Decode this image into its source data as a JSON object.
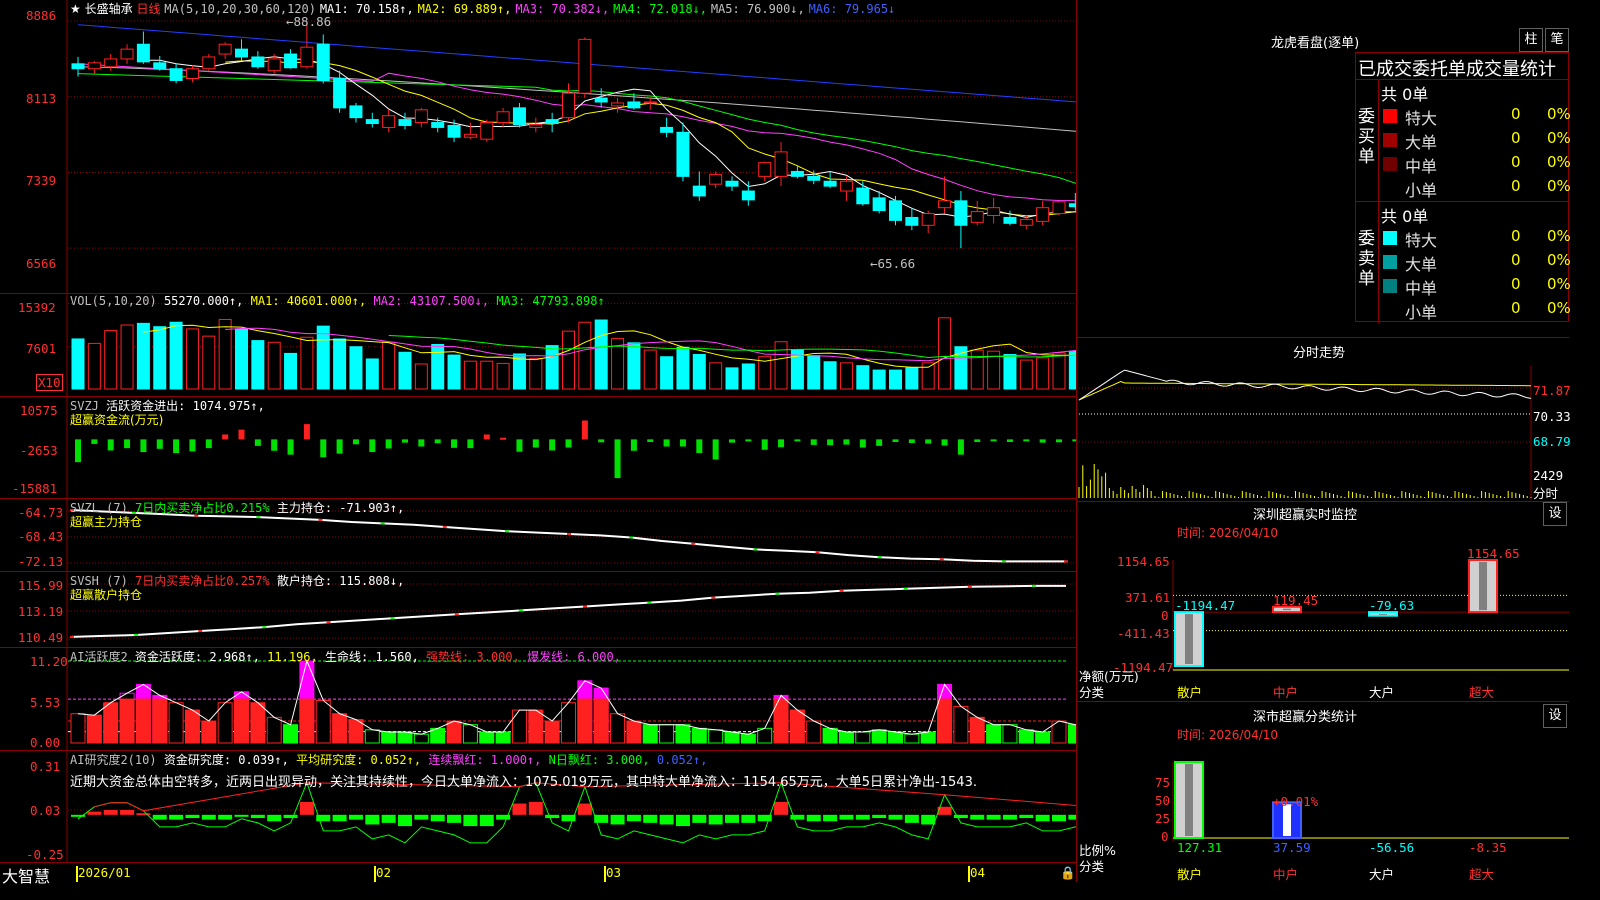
{
  "colors": {
    "up": "#ff2020",
    "down": "#00ffff",
    "ma1": "#ffffff",
    "ma2": "#ffff00",
    "ma3": "#ff40ff",
    "ma4": "#00ff00",
    "ma5": "#c0c0c0",
    "ma6": "#2040ff",
    "grid": "#8a0000"
  },
  "header": {
    "star_icon": "star-icon",
    "stock_name": "长盛轴承",
    "period": "日线",
    "ma_label": "MA(5,10,20,30,60,120)",
    "ma1": "MA1: 70.158↑,",
    "ma2": "MA2: 69.889↑,",
    "ma3": "MA3: 70.382↓,",
    "ma4": "MA4: 72.018↓,",
    "ma5": "MA5: 76.900↓,",
    "ma6": "MA6: 79.965↓"
  },
  "price_axis": [
    "8886",
    "8113",
    "7339",
    "6566"
  ],
  "price_marks": {
    "high": "88.86",
    "low": "65.66"
  },
  "vol": {
    "title": "VOL(5,10,20)",
    "value": "55270.000↑,",
    "ma1": "MA1: 40601.000↑,",
    "ma2": "MA2: 43107.500↓,",
    "ma3": "MA3: 47793.898↑",
    "axis": [
      "15392",
      "7601"
    ],
    "unit": "X10"
  },
  "svzj": {
    "title": "SVZJ",
    "text": "活跃资金进出: 1074.975↑,",
    "sub": "超赢资金流(万元)",
    "axis": [
      "10575",
      "-2653",
      "-15881"
    ]
  },
  "svzl": {
    "title": "SVZL (7)",
    "text1": "7日内买卖净占比0.215%",
    "text2": "主力持仓: -71.903↑,",
    "sub": "超赢主力持仓",
    "axis": [
      "-64.73",
      "-68.43",
      "-72.13"
    ]
  },
  "svsh": {
    "title": "SVSH (7)",
    "text1": "7日内买卖净占比0.257%",
    "text2": "散户持仓: 115.808↓,",
    "sub": "超赢散户持仓",
    "axis": [
      "115.99",
      "113.19",
      "110.49"
    ]
  },
  "ai1": {
    "title": "AI活跃度2",
    "t1": "资金活跃度: 2.968↑,",
    "t2": "11.196,",
    "t3": "生命线: 1.560,",
    "t4": "强势线: 3.000,",
    "t5": "爆发线: 6.000,",
    "axis": [
      "11.20",
      "5.53",
      "0.00"
    ]
  },
  "ai2": {
    "title": "AI研究度2(10)",
    "t1": "资金研究度: 0.039↑,",
    "t2": "平均研究度: 0.052↑,",
    "t3": "连续飘红: 1.000↑,",
    "t4": "N日飘红: 3.000,",
    "t5": "0.052↑,",
    "comment": "近期大资金总体由空转多，近两日出现异动，关注其持续性，今日大单净流入：1075.019万元，其中特大单净流入：1154.65万元，大单5日累计净出-1543.",
    "axis": [
      "0.31",
      "0.03",
      "-0.25"
    ]
  },
  "date_axis": [
    "2026/01",
    "02",
    "03",
    "04"
  ],
  "footer": {
    "brand": "大智慧",
    "lock_icon": "lock-icon"
  },
  "dragon": {
    "title": "龙虎看盘(逐单)",
    "btn1": "柱",
    "btn2": "笔",
    "tabs": "已成交委托单成交量统计",
    "buy_label": "委买单",
    "sell_label": "委卖单",
    "buy_total": "共 0单",
    "sell_total": "共 0单",
    "buy_rows": [
      {
        "name": "特大",
        "v": "0",
        "p": "0%",
        "c": "#ff0000"
      },
      {
        "name": "大单",
        "v": "0",
        "p": "0%",
        "c": "#a00000"
      },
      {
        "name": "中单",
        "v": "0",
        "p": "0%",
        "c": "#700000"
      },
      {
        "name": "小单",
        "v": "0",
        "p": "0%",
        "c": ""
      }
    ],
    "sell_rows": [
      {
        "name": "特大",
        "v": "0",
        "p": "0%",
        "c": "#00ffff"
      },
      {
        "name": "大单",
        "v": "0",
        "p": "0%",
        "c": "#00a0a0"
      },
      {
        "name": "中单",
        "v": "0",
        "p": "0%",
        "c": "#008080"
      },
      {
        "name": "小单",
        "v": "0",
        "p": "0%",
        "c": ""
      }
    ]
  },
  "intraday": {
    "title": "分时走势",
    "axis": [
      "71.87",
      "70.33",
      "68.79"
    ],
    "vol_axis": [
      "2429"
    ],
    "vol_unit": "分时"
  },
  "sz_monitor": {
    "title": "深圳超赢实时监控",
    "btn": "设",
    "time": "时间: 2026/04/10",
    "axis": [
      "1154.65",
      "371.61",
      "0",
      "-411.43",
      "-1194.47"
    ],
    "ylabel": "净额(万元)",
    "xlabel": "分类",
    "categories": [
      "散户",
      "中户",
      "大户",
      "超大"
    ],
    "values_label": [
      "-1194.47",
      "119.45",
      "-79.63",
      "1154.65"
    ]
  },
  "sz_class": {
    "title": "深市超赢分类统计",
    "btn": "设",
    "time": "时间: 2026/04/10",
    "axis": [
      "75",
      "50",
      "25",
      "0"
    ],
    "ylabel": "比例%",
    "xlabel": "分类",
    "categories": [
      "散户",
      "中户",
      "大户",
      "超大"
    ],
    "values_label": [
      "127.31",
      "37.59",
      "-56.56",
      "-8.35"
    ],
    "note": "+0.01%"
  },
  "chart_data": [
    {
      "type": "candlestick",
      "title": "长盛轴承 日线",
      "ylabel": "",
      "ylim": [
        62,
        90
      ],
      "ohlc": [
        [
          84.5,
          85.2,
          83.2,
          84.0
        ],
        [
          84.0,
          84.8,
          83.5,
          84.6
        ],
        [
          84.2,
          85.5,
          83.8,
          85.0
        ],
        [
          85.0,
          86.5,
          84.5,
          86.0
        ],
        [
          86.5,
          87.8,
          84.5,
          84.7
        ],
        [
          84.6,
          85.3,
          83.8,
          84.0
        ],
        [
          84.0,
          84.5,
          82.5,
          82.8
        ],
        [
          83.0,
          84.3,
          82.6,
          84.0
        ],
        [
          84.0,
          85.5,
          83.8,
          85.2
        ],
        [
          85.5,
          86.7,
          85.0,
          86.5
        ],
        [
          86.0,
          87.0,
          84.8,
          85.2
        ],
        [
          85.2,
          85.8,
          84.0,
          84.2
        ],
        [
          83.8,
          85.5,
          83.5,
          85.0
        ],
        [
          85.5,
          86.0,
          84.0,
          84.1
        ],
        [
          84.2,
          88.86,
          84.0,
          86.2
        ],
        [
          86.5,
          87.5,
          82.5,
          82.8
        ],
        [
          83.0,
          83.8,
          79.5,
          80.0
        ],
        [
          80.2,
          80.5,
          78.5,
          79.0
        ],
        [
          78.8,
          79.5,
          78.0,
          78.4
        ],
        [
          78.0,
          79.8,
          77.5,
          79.2
        ],
        [
          78.8,
          79.5,
          77.8,
          78.2
        ],
        [
          78.5,
          80.0,
          78.0,
          79.8
        ],
        [
          78.5,
          79.0,
          77.5,
          78.0
        ],
        [
          78.2,
          78.8,
          76.5,
          77.0
        ],
        [
          77.0,
          78.5,
          76.8,
          77.3
        ],
        [
          76.8,
          78.8,
          76.5,
          78.5
        ],
        [
          78.5,
          80.0,
          78.0,
          79.6
        ],
        [
          80.0,
          80.5,
          78.0,
          78.3
        ],
        [
          78.0,
          79.0,
          77.5,
          78.3
        ],
        [
          78.8,
          79.5,
          77.5,
          78.4
        ],
        [
          79.0,
          82.5,
          78.5,
          81.5
        ],
        [
          81.5,
          87.2,
          81.0,
          87.0
        ],
        [
          81.0,
          82.0,
          80.0,
          80.6
        ],
        [
          80.2,
          81.0,
          79.5,
          80.5
        ],
        [
          80.6,
          81.5,
          79.8,
          80.0
        ],
        [
          80.5,
          81.0,
          79.8,
          80.6
        ],
        [
          78.0,
          79.0,
          77.0,
          77.5
        ],
        [
          77.5,
          78.5,
          72.5,
          73.0
        ],
        [
          72.0,
          73.5,
          70.5,
          71.0
        ],
        [
          72.2,
          73.5,
          71.8,
          73.2
        ],
        [
          72.5,
          73.0,
          71.5,
          72.0
        ],
        [
          71.5,
          72.5,
          70.0,
          70.6
        ],
        [
          73.0,
          74.5,
          72.5,
          74.4
        ],
        [
          73.0,
          76.5,
          72.0,
          75.5
        ],
        [
          73.5,
          74.0,
          72.8,
          73.0
        ],
        [
          73.0,
          73.6,
          72.2,
          72.6
        ],
        [
          72.5,
          73.5,
          71.8,
          72.0
        ],
        [
          71.5,
          73.0,
          70.5,
          72.5
        ],
        [
          71.8,
          72.5,
          70.0,
          70.2
        ],
        [
          70.8,
          71.5,
          69.2,
          69.5
        ],
        [
          70.5,
          71.0,
          68.0,
          68.5
        ],
        [
          68.8,
          69.8,
          67.5,
          68.0
        ],
        [
          68.0,
          69.5,
          67.2,
          69.2
        ],
        [
          69.8,
          73.0,
          69.2,
          70.5
        ],
        [
          70.5,
          71.5,
          65.66,
          68.0
        ],
        [
          68.3,
          70.5,
          68.0,
          69.4
        ],
        [
          69.0,
          70.8,
          68.2,
          69.8
        ],
        [
          68.8,
          69.5,
          68.0,
          68.2
        ],
        [
          68.0,
          69.0,
          67.6,
          68.6
        ],
        [
          68.4,
          70.5,
          68.0,
          69.8
        ],
        [
          69.2,
          70.5,
          69.0,
          70.4
        ],
        [
          70.2,
          71.3,
          69.5,
          69.9
        ],
        [
          70.3,
          70.6,
          68.3,
          68.5
        ],
        [
          68.5,
          69.5,
          68.2,
          69.0
        ],
        [
          70.0,
          70.8,
          69.5,
          70.6
        ],
        [
          70.8,
          71.3,
          69.9,
          70.0
        ],
        [
          70.1,
          71.8,
          70.0,
          70.5
        ]
      ],
      "ma_series": [
        {
          "name": "MA1",
          "last": 70.158
        },
        {
          "name": "MA2",
          "last": 69.889
        },
        {
          "name": "MA3",
          "last": 70.382
        },
        {
          "name": "MA4",
          "last": 72.018
        },
        {
          "name": "MA5",
          "last": 76.9
        },
        {
          "name": "MA6",
          "last": 79.965
        }
      ]
    },
    {
      "type": "bar",
      "title": "VOL(5,10,20)",
      "ylim": [
        0,
        16000
      ],
      "values": [
        9000,
        8200,
        10500,
        11500,
        11800,
        11200,
        12000,
        10800,
        9500,
        12500,
        10800,
        8700,
        8400,
        6400,
        9300,
        11300,
        9000,
        7600,
        5400,
        8400,
        6600,
        4500,
        8000,
        6100,
        5000,
        5000,
        4600,
        6300,
        5500,
        7800,
        10400,
        12000,
        12400,
        9100,
        8300,
        7000,
        5800,
        7500,
        6200,
        4700,
        3800,
        4500,
        5800,
        8500,
        7100,
        6000,
        4900,
        4700,
        4200,
        3400,
        3400,
        3800,
        4700,
        12800,
        7600,
        7000,
        6800,
        6200,
        5200,
        5600,
        6500,
        6800,
        5200,
        4800,
        6300,
        5600,
        5500
      ]
    },
    {
      "type": "bar",
      "title": "SVZJ",
      "ylim": [
        -15881,
        10575
      ],
      "values": [
        -7000,
        -1400,
        -3400,
        -2700,
        -3900,
        -2900,
        -4200,
        -3700,
        -2700,
        1500,
        3000,
        -2000,
        -3500,
        -4700,
        4700,
        -5500,
        -4400,
        -1500,
        -3900,
        -2800,
        -1000,
        -2200,
        -1200,
        -2600,
        -2700,
        1500,
        500,
        -3800,
        -2500,
        -3400,
        -2500,
        5800,
        -900,
        -11900,
        -3500,
        -800,
        -2200,
        -2200,
        -4200,
        -6200,
        -1000,
        -500,
        -3200,
        -2400,
        -500,
        -1700,
        -1800,
        -1600,
        -2500,
        -2000,
        -800,
        -1100,
        -1300,
        -1900,
        -4700,
        -800,
        -600,
        -800,
        -500,
        -1000,
        -900,
        -600,
        -400,
        -600,
        -500,
        -1500,
        200
      ]
    },
    {
      "type": "line",
      "title": "SVZL (7)",
      "ylim": [
        -72.13,
        -64.73
      ],
      "values": [
        -64.6,
        -64.8,
        -65.0,
        -65.2,
        -65.4,
        -65.5,
        -65.6,
        -65.8,
        -66.0,
        -66.3,
        -66.5,
        -66.7,
        -67.0,
        -67.3,
        -67.6,
        -67.8,
        -68.0,
        -68.2,
        -68.5,
        -69.0,
        -69.4,
        -69.8,
        -70.2,
        -70.4,
        -70.6,
        -71.0,
        -71.3,
        -71.5,
        -71.6,
        -71.8,
        -71.9,
        -71.9,
        -71.9
      ]
    },
    {
      "type": "line",
      "title": "SVSH (7)",
      "ylim": [
        110.49,
        115.99
      ],
      "values": [
        110.6,
        110.7,
        110.8,
        111.0,
        111.2,
        111.4,
        111.6,
        111.9,
        112.1,
        112.3,
        112.5,
        112.7,
        112.9,
        113.1,
        113.3,
        113.5,
        113.7,
        113.9,
        114.1,
        114.3,
        114.6,
        114.8,
        115.0,
        115.1,
        115.3,
        115.4,
        115.5,
        115.6,
        115.7,
        115.75,
        115.8,
        115.8
      ]
    },
    {
      "type": "bar",
      "title": "AI活跃度2",
      "ylim": [
        0,
        11.2
      ],
      "values": [
        4.0,
        3.8,
        5.5,
        6.8,
        8.0,
        6.5,
        5.5,
        4.5,
        3.0,
        5.5,
        7.0,
        5.5,
        3.5,
        2.5,
        11.2,
        5.8,
        4.0,
        3.2,
        1.8,
        1.5,
        1.5,
        1.2,
        2.0,
        3.0,
        2.5,
        1.5,
        1.5,
        4.5,
        4.5,
        3.0,
        5.5,
        8.5,
        7.5,
        4.0,
        3.0,
        2.5,
        2.5,
        2.5,
        2.0,
        1.8,
        1.5,
        1.2,
        2.0,
        6.5,
        4.5,
        3.0,
        2.0,
        1.5,
        1.5,
        1.8,
        1.5,
        1.2,
        1.5,
        8.0,
        5.0,
        3.5,
        2.5,
        2.5,
        1.8,
        1.5,
        3.0,
        2.5,
        2.0,
        1.5,
        1.8,
        3.0,
        2.5,
        3.0
      ],
      "lines": {
        "life": 1.56,
        "strong": 3.0,
        "burst": 6.0
      }
    },
    {
      "type": "bar",
      "title": "AI研究度2(10)",
      "ylim": [
        -0.25,
        0.31
      ],
      "values": [
        -0.01,
        0.02,
        0.03,
        0.03,
        0.01,
        -0.03,
        -0.03,
        -0.02,
        -0.03,
        -0.03,
        -0.01,
        -0.02,
        -0.04,
        -0.02,
        0.08,
        -0.04,
        -0.04,
        -0.03,
        -0.06,
        -0.05,
        -0.07,
        -0.03,
        -0.04,
        -0.05,
        -0.07,
        -0.07,
        -0.03,
        0.07,
        0.08,
        -0.02,
        -0.04,
        0.07,
        -0.05,
        -0.06,
        -0.04,
        -0.05,
        -0.06,
        -0.07,
        -0.05,
        -0.06,
        -0.05,
        -0.05,
        -0.04,
        0.08,
        -0.03,
        -0.04,
        -0.04,
        -0.03,
        -0.03,
        -0.02,
        -0.03,
        -0.05,
        -0.06,
        0.05,
        -0.02,
        -0.03,
        -0.03,
        -0.03,
        -0.02,
        -0.04,
        -0.04,
        -0.03,
        -0.03,
        -0.02,
        -0.03,
        0.01,
        0.02
      ]
    },
    {
      "type": "bar",
      "title": "深圳超赢实时监控",
      "categories": [
        "散户",
        "中户",
        "大户",
        "超大"
      ],
      "values": [
        -1194.47,
        119.45,
        -79.63,
        1154.65
      ],
      "ylim": [
        -1194.47,
        1154.65
      ]
    },
    {
      "type": "bar",
      "title": "深市超赢分类统计",
      "categories": [
        "散户",
        "中户",
        "大户",
        "超大"
      ],
      "values": [
        127.31,
        37.59,
        -56.56,
        -8.35
      ],
      "ylim": [
        0,
        75
      ]
    }
  ]
}
